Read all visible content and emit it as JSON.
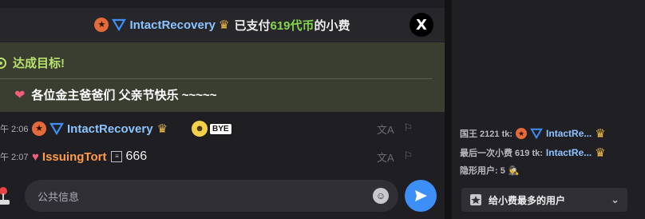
{
  "tip_banner": {
    "username": "IntactRecovery",
    "text_before": "已支付",
    "amount": "619代币",
    "text_after": "的小费",
    "close_label": "X"
  },
  "goal": {
    "title": "达成目标!",
    "message": "各位金主爸爸们 父亲节快乐 ~~~~~"
  },
  "messages": [
    {
      "time": "午 2:06",
      "username": "IntactRecovery",
      "sticker_text": "BYE"
    },
    {
      "time": "午 2:07",
      "username": "IssuingTort",
      "text": "666"
    }
  ],
  "input": {
    "placeholder": "公共信息"
  },
  "side": {
    "king_label": "国王 2121 tk:",
    "king_user": "IntactRe...",
    "last_tip_label": "最后一次小费 619 tk:",
    "last_tip_user": "IntactRe...",
    "hidden_users": "隐形用户: 5",
    "top_tippers_button": "给小费最多的用户"
  },
  "colors": {
    "accent_blue": "#3d8ef7",
    "username_blue": "#8cc4ff",
    "amount_green": "#84d44c",
    "goal_bg": "#3a3e31"
  },
  "icons": [
    "star-badge-icon",
    "tri-badge-icon",
    "crown-icon",
    "x-logo-icon",
    "target-icon",
    "heart-icon",
    "translate-icon",
    "report-icon",
    "emoji-icon",
    "send-icon",
    "joystick-icon",
    "incognito-icon",
    "chevron-down-icon",
    "medal-icon"
  ]
}
